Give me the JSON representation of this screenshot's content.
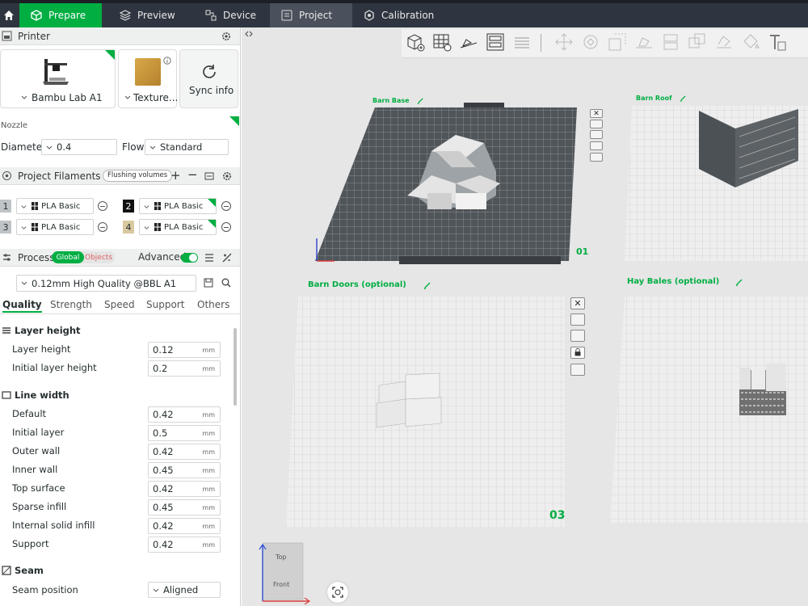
{
  "tabs": {
    "prepare": "Prepare",
    "preview": "Preview",
    "device": "Device",
    "project": "Project",
    "calibration": "Calibration"
  },
  "printer": {
    "section": "Printer",
    "model": "Bambu Lab A1",
    "plate": "Texture...",
    "sync": "Sync info",
    "nozzle": "Nozzle",
    "diameter_label": "Diameter",
    "diameter": "0.4",
    "flow_label": "Flow",
    "flow": "Standard"
  },
  "filaments": {
    "section": "Project Filaments",
    "flushing": "Flushing volumes",
    "items": [
      {
        "num": "1",
        "name": "PLA Basic"
      },
      {
        "num": "2",
        "name": "PLA Basic"
      },
      {
        "num": "3",
        "name": "PLA Basic"
      },
      {
        "num": "4",
        "name": "PLA Basic"
      }
    ]
  },
  "process": {
    "section": "Process",
    "global": "Global",
    "objects": "Objects",
    "advanced": "Advanced",
    "preset": "0.12mm High Quality @BBL A1",
    "tabs": [
      "Quality",
      "Strength",
      "Speed",
      "Support",
      "Others"
    ],
    "layer_height_group": "Layer height",
    "line_width_group": "Line width",
    "seam_group": "Seam",
    "unit": "mm",
    "params": [
      {
        "label": "Layer height",
        "value": "0.12"
      },
      {
        "label": "Initial layer height",
        "value": "0.2"
      },
      {
        "label": "Default",
        "value": "0.42"
      },
      {
        "label": "Initial layer",
        "value": "0.5"
      },
      {
        "label": "Outer wall",
        "value": "0.42"
      },
      {
        "label": "Inner wall",
        "value": "0.45"
      },
      {
        "label": "Top surface",
        "value": "0.42"
      },
      {
        "label": "Sparse infill",
        "value": "0.45"
      },
      {
        "label": "Internal solid infill",
        "value": "0.42"
      },
      {
        "label": "Support",
        "value": "0.42"
      }
    ],
    "seam_label": "Seam position",
    "seam_value": "Aligned"
  },
  "plates": [
    {
      "name": "Barn Base",
      "num": "01"
    },
    {
      "name": "Barn Roof"
    },
    {
      "name": "Barn Doors (optional)",
      "num": "03"
    },
    {
      "name": "Hay Bales (optional)"
    }
  ],
  "navcube": {
    "top": "Top",
    "front": "Front"
  },
  "colors": {
    "accent": "#00ae42",
    "topbar": "#2f3540",
    "filament2": "#111111",
    "filament4": "#d9c9a0"
  }
}
